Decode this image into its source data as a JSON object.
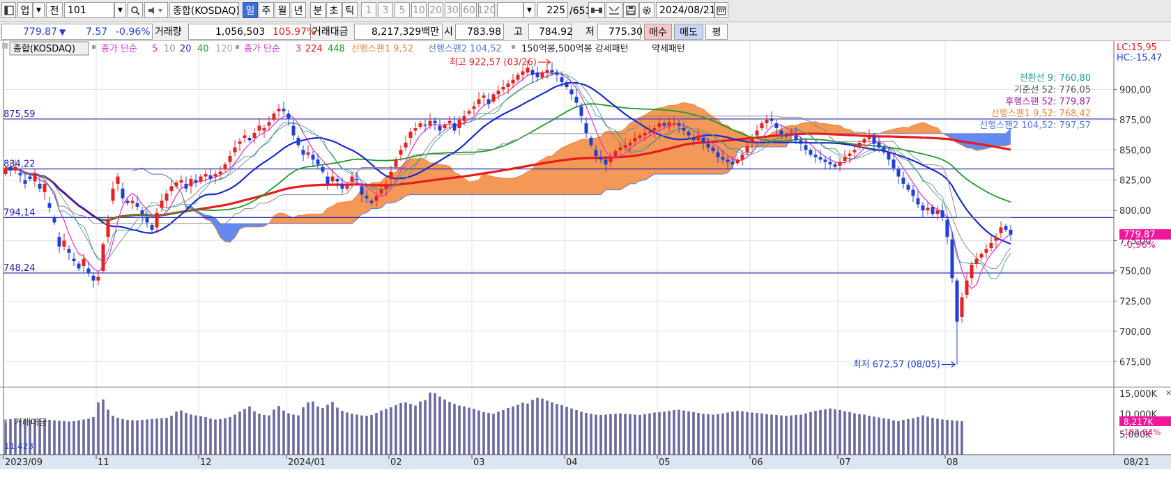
{
  "toolbar": {
    "market": "업",
    "prev_label": "전",
    "code": "101",
    "name": "종합(KOSDAQ)",
    "periods": [
      "일",
      "주",
      "월",
      "년",
      "분",
      "초",
      "틱"
    ],
    "intervals": [
      "1",
      "3",
      "5",
      "10",
      "20",
      "30",
      "60",
      "120"
    ],
    "count_value": "225",
    "count_total": "/651",
    "date": "2024/08/21"
  },
  "quote": {
    "price": "779.87",
    "change": "7.57",
    "change_pct": "-0.96%",
    "volume_label": "거래량",
    "volume": "1,056,503",
    "volume_pct": "105.97%",
    "amount_label": "거래대금",
    "amount": "8,217,329백만",
    "open_label": "시",
    "open": "783.98",
    "high_label": "고",
    "high": "784.92",
    "low_label": "저",
    "low": "775.30",
    "buy_label": "매수",
    "sell_label": "매도",
    "eval_label": "평"
  },
  "colors": {
    "up": "#e8201f",
    "down": "#1f40d8",
    "cloud_up": "#f2924e",
    "cloud_down": "#5c83ee",
    "ma5": "#d732d0",
    "ma10": "#8c8c8c",
    "ma20": "#1a2ac8",
    "ma40": "#1f9b2a",
    "ma120": "#e81a1a"
  },
  "chart_data": {
    "type": "candlestick",
    "title": "종합(KOSDAQ)",
    "legend": {
      "main": "종합(KOSDAQ)",
      "ma_a_label": "종가 단순",
      "ma_a_periods": [
        "5",
        "10",
        "20",
        "40",
        "120"
      ],
      "ma_b_label": "종가 단순",
      "ma_b_periods": [
        "3",
        "224",
        "448"
      ],
      "span1": "선행스팬1 9,52",
      "span2": "선행스팬2 104,52",
      "pattern": "150억봉,500억봉 강세패턴",
      "pattern_weak": "약세패턴"
    },
    "corner": {
      "lc": "LC:15,95",
      "hc": "HC:-15,47"
    },
    "price_axis": {
      "ylim": [
        655,
        940
      ],
      "ticks": [
        675,
        700,
        725,
        750,
        775,
        800,
        825,
        850,
        875,
        900
      ],
      "tick_labels": [
        "675,00",
        "700,00",
        "725,00",
        "750,00",
        "775,00",
        "800,00",
        "825,00",
        "850,00",
        "875,00",
        "900,00"
      ]
    },
    "x_labels": [
      {
        "label": "2023/09",
        "i": 0
      },
      {
        "label": "11",
        "i": 19
      },
      {
        "label": "12",
        "i": 40
      },
      {
        "label": "2024/01",
        "i": 58
      },
      {
        "label": "02",
        "i": 79
      },
      {
        "label": "03",
        "i": 96
      },
      {
        "label": "04",
        "i": 115
      },
      {
        "label": "05",
        "i": 134
      },
      {
        "label": "06",
        "i": 153
      },
      {
        "label": "07",
        "i": 171
      },
      {
        "label": "08",
        "i": 193
      }
    ],
    "x_end_label": "08/21",
    "hlines": [
      {
        "value": 875.59,
        "label": "875,59"
      },
      {
        "value": 834.22,
        "label": "834,22"
      },
      {
        "value": 794.14,
        "label": "794,14"
      },
      {
        "value": 748.24,
        "label": "748,24"
      }
    ],
    "high_marker": {
      "label": "최고 922,57 (03/26)",
      "value": 922.57,
      "i": 112
    },
    "low_marker": {
      "label": "최저 672,57 (08/05)",
      "value": 672.57,
      "i": 195
    },
    "ichimoku_labels": [
      {
        "text": "전환선 9: 760,80",
        "color": "#1f9a8a"
      },
      {
        "text": "기준선 52: 776,05",
        "color": "#555555"
      },
      {
        "text": "후행스팬 52: 779,87",
        "color": "#9a1fa8"
      },
      {
        "text": "선행스팬1 9,52: 768,42",
        "color": "#e88a40"
      },
      {
        "text": "선행스팬2 104,52: 797,57",
        "color": "#5a7ae0"
      }
    ],
    "current_price_tag": {
      "value": 779.87,
      "label": "779,87",
      "pct": "-0,96%"
    },
    "candles_close": [
      835,
      833,
      836,
      829,
      822,
      826,
      830,
      818,
      822,
      802,
      790,
      770,
      775,
      765,
      758,
      752,
      760,
      748,
      742,
      745,
      772,
      792,
      818,
      828,
      810,
      806,
      808,
      803,
      797,
      790,
      784,
      798,
      808,
      814,
      820,
      823,
      825,
      818,
      826,
      823,
      828,
      830,
      826,
      830,
      832,
      838,
      845,
      852,
      857,
      862,
      858,
      864,
      870,
      868,
      873,
      880,
      884,
      882,
      876,
      862,
      854,
      846,
      848,
      842,
      838,
      832,
      822,
      828,
      824,
      818,
      821,
      828,
      825,
      813,
      810,
      806,
      812,
      817,
      822,
      832,
      842,
      850,
      856,
      865,
      868,
      872,
      870,
      874,
      872,
      866,
      871,
      874,
      866,
      875,
      878,
      882,
      886,
      892,
      895,
      888,
      896,
      899,
      902,
      905,
      908,
      912,
      915,
      918,
      912,
      910,
      914,
      916,
      914,
      912,
      906,
      902,
      896,
      889,
      878,
      864,
      854,
      845,
      842,
      838,
      843,
      849,
      852,
      854,
      856,
      860,
      862,
      864,
      865,
      868,
      872,
      870,
      873,
      872,
      870,
      866,
      862,
      858,
      862,
      856,
      852,
      849,
      844,
      842,
      840,
      838,
      842,
      846,
      853,
      860,
      866,
      872,
      875,
      874,
      868,
      863,
      861,
      864,
      858,
      855,
      850,
      846,
      844,
      842,
      840,
      838,
      836,
      840,
      844,
      847,
      850,
      856,
      859,
      861,
      855,
      852,
      848,
      842,
      835,
      828,
      822,
      817,
      812,
      805,
      800,
      802,
      797,
      800,
      794,
      778,
      744,
      708,
      728,
      742,
      755,
      760,
      764,
      768,
      773,
      778,
      786,
      784,
      780
    ],
    "candles_open": [
      830,
      836,
      833,
      831,
      825,
      828,
      824,
      822,
      815,
      806,
      794,
      778,
      770,
      768,
      760,
      756,
      754,
      752,
      746,
      742,
      750,
      778,
      808,
      822,
      818,
      808,
      806,
      806,
      800,
      794,
      788,
      786,
      802,
      808,
      816,
      820,
      823,
      822,
      820,
      825,
      824,
      828,
      829,
      828,
      830,
      834,
      840,
      848,
      855,
      860,
      860,
      860,
      866,
      866,
      870,
      875,
      882,
      884,
      880,
      870,
      860,
      850,
      846,
      846,
      842,
      836,
      828,
      824,
      826,
      822,
      818,
      824,
      826,
      820,
      812,
      808,
      808,
      814,
      818,
      826,
      836,
      846,
      852,
      860,
      866,
      869,
      871,
      870,
      874,
      870,
      868,
      872,
      872,
      868,
      874,
      880,
      884,
      888,
      893,
      892,
      890,
      896,
      900,
      902,
      905,
      908,
      912,
      914,
      916,
      914,
      910,
      914,
      916,
      914,
      910,
      906,
      900,
      894,
      886,
      872,
      860,
      850,
      844,
      842,
      840,
      845,
      850,
      852,
      854,
      857,
      860,
      862,
      864,
      866,
      869,
      872,
      870,
      872,
      872,
      868,
      865,
      860,
      858,
      860,
      855,
      852,
      848,
      844,
      842,
      840,
      839,
      842,
      848,
      856,
      862,
      868,
      872,
      876,
      872,
      866,
      862,
      862,
      862,
      858,
      854,
      850,
      846,
      844,
      842,
      840,
      838,
      837,
      841,
      845,
      848,
      852,
      856,
      859,
      861,
      856,
      852,
      848,
      842,
      834,
      827,
      821,
      817,
      810,
      804,
      800,
      803,
      797,
      800,
      792,
      776,
      742,
      712,
      730,
      744,
      756,
      761,
      765,
      769,
      775,
      781,
      787,
      784
    ],
    "volume": {
      "label": "거래대금",
      "ylim": [
        0,
        16000
      ],
      "ticks": [
        5000,
        10000,
        15000
      ],
      "tick_labels": [
        "5,000K",
        "10,000K",
        "15,000K"
      ],
      "current_label": "8,217K",
      "current_pct": "102,84%",
      "first_label": "11,423",
      "values": [
        8600,
        8700,
        8800,
        8600,
        8700,
        8500,
        8700,
        8800,
        8600,
        8500,
        8400,
        8300,
        8200,
        8100,
        8200,
        8400,
        8600,
        8800,
        9200,
        12800,
        13500,
        11000,
        9500,
        9000,
        8700,
        8500,
        8400,
        8400,
        8500,
        8600,
        8700,
        8800,
        8900,
        9000,
        9500,
        10500,
        10800,
        10200,
        9800,
        9600,
        9400,
        9200,
        8800,
        8600,
        8700,
        8900,
        9200,
        9800,
        10500,
        11200,
        11800,
        10600,
        10000,
        9700,
        9600,
        11000,
        11900,
        10800,
        10100,
        9800,
        9600,
        11600,
        12800,
        13000,
        11800,
        11400,
        12200,
        12900,
        11500,
        10700,
        10300,
        10000,
        9800,
        9600,
        9500,
        9700,
        10200,
        10800,
        11200,
        11600,
        12100,
        12600,
        12800,
        12400,
        12000,
        13000,
        13300,
        15200,
        15000,
        14200,
        13500,
        12900,
        12400,
        12000,
        11800,
        11500,
        11200,
        10800,
        10400,
        10200,
        10000,
        10500,
        10900,
        11400,
        11800,
        12200,
        12700,
        12500,
        13400,
        13900,
        13700,
        13200,
        12800,
        12400,
        12100,
        11700,
        11300,
        10900,
        10500,
        10200,
        10000,
        9800,
        9700,
        9800,
        9900,
        10000,
        10100,
        10000,
        9900,
        9800,
        9700,
        9900,
        10100,
        10300,
        10400,
        10500,
        10700,
        10900,
        11000,
        10800,
        10600,
        10400,
        10200,
        10000,
        9900,
        9800,
        9900,
        10100,
        10300,
        10500,
        10700,
        10600,
        10400,
        10300,
        10200,
        10100,
        9900,
        9800,
        9700,
        9600,
        9500,
        9600,
        9700,
        9800,
        10100,
        10400,
        10700,
        10900,
        11100,
        11300,
        11100,
        10900,
        10600,
        10400,
        10100,
        9900,
        9800,
        9500,
        9300,
        9100,
        8900,
        8700,
        8400,
        8200,
        8500,
        8700,
        8900,
        9200,
        9600,
        9300,
        9000,
        8800,
        8600,
        8500,
        8400,
        8300,
        8200
      ]
    }
  }
}
